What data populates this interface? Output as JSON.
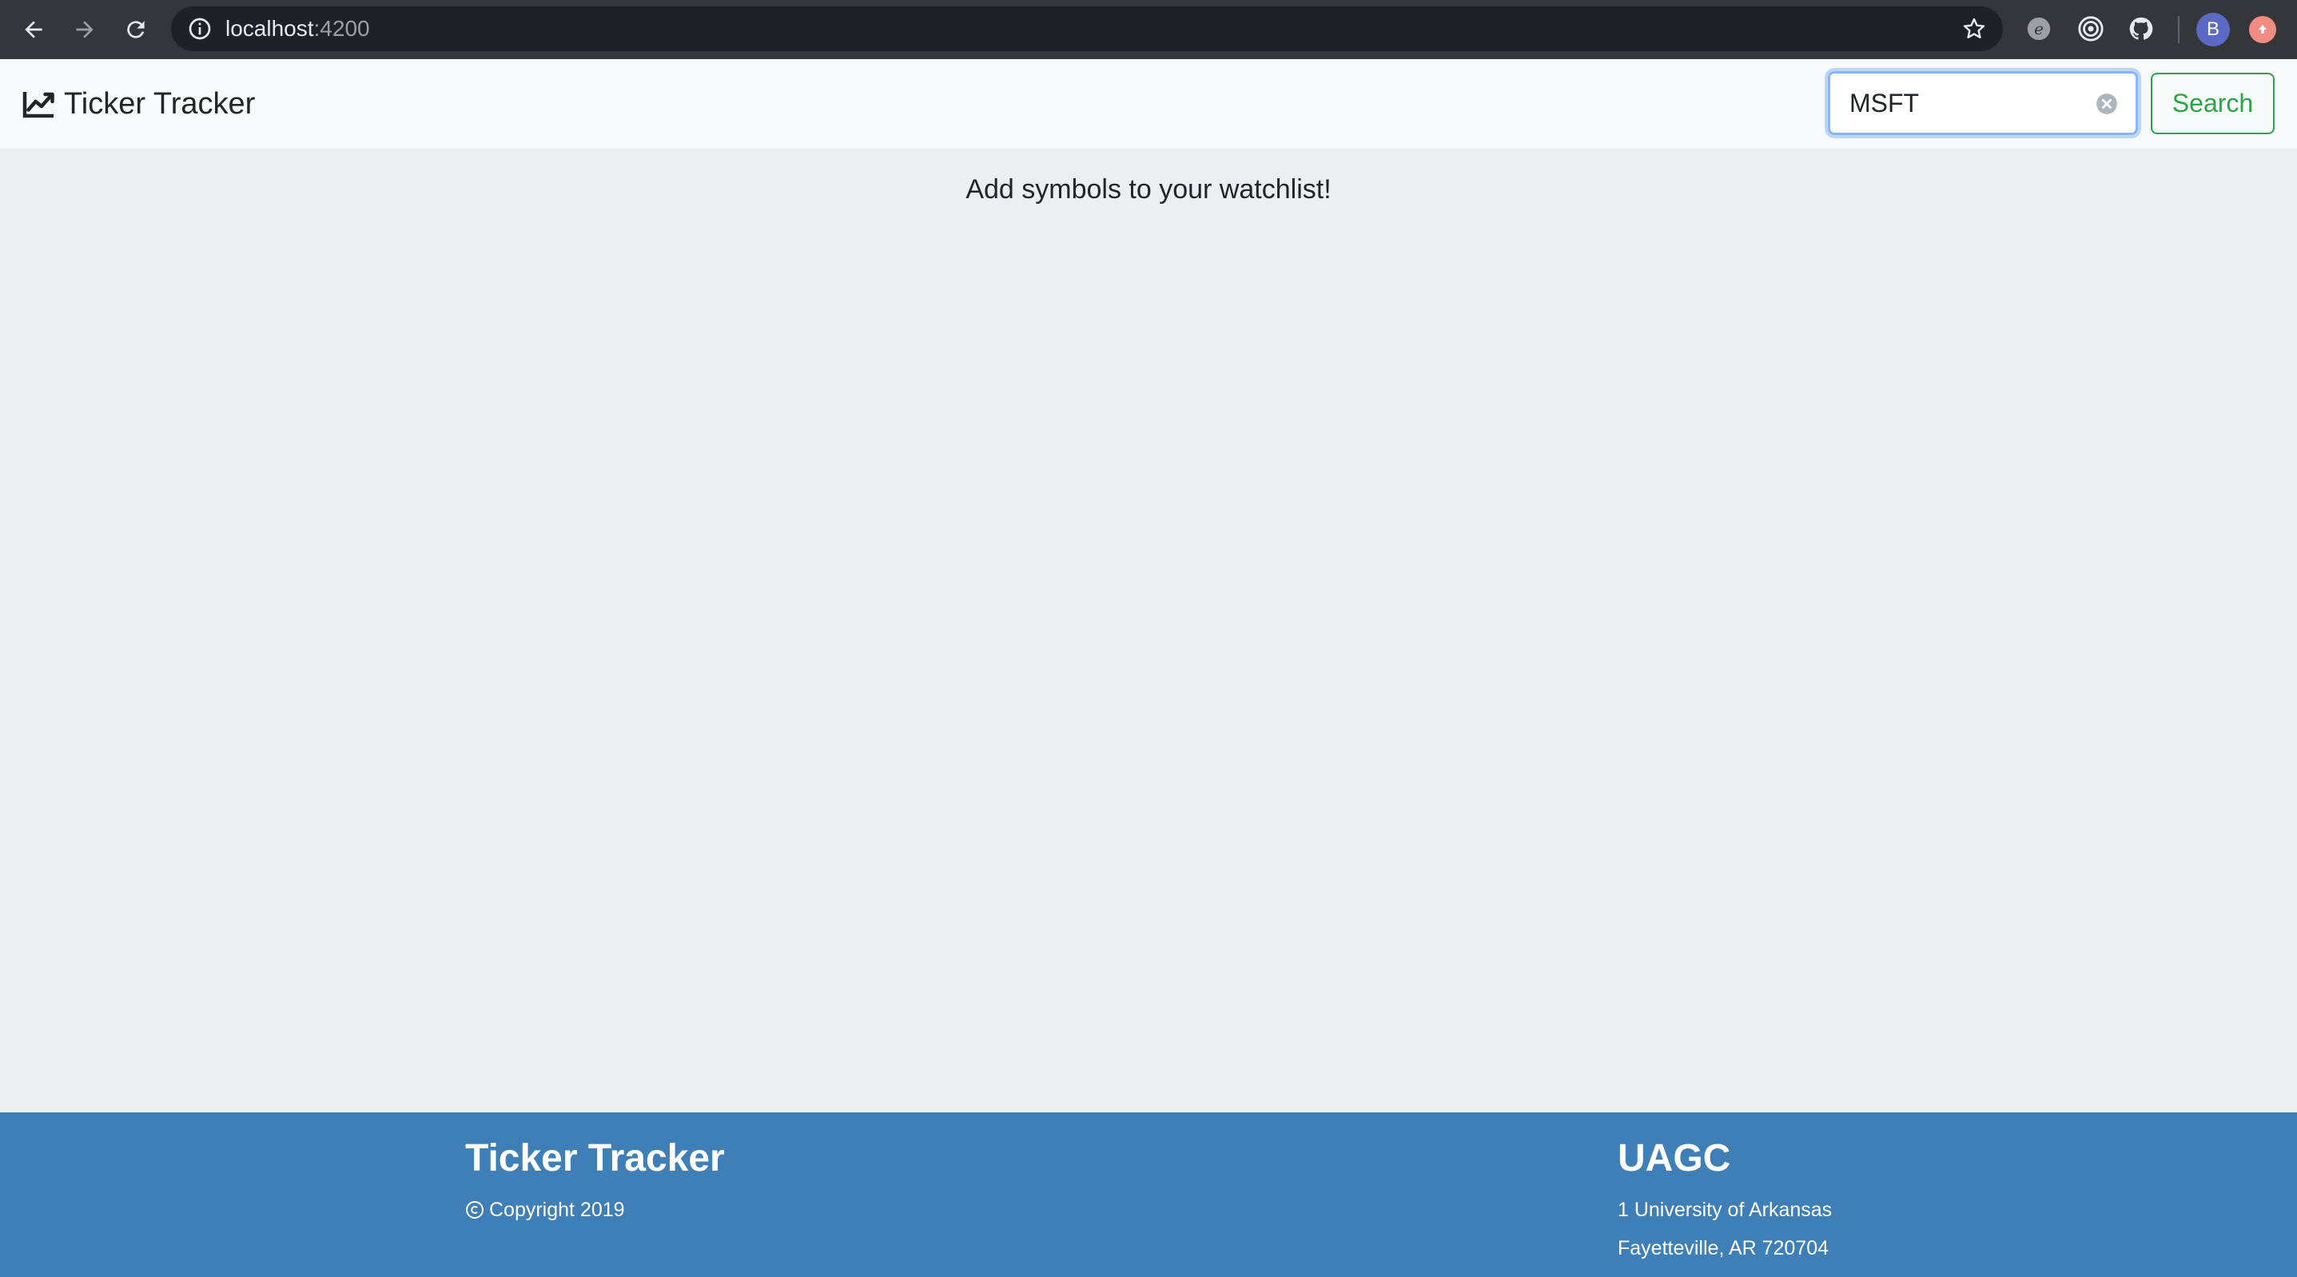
{
  "browser": {
    "url_host": "localhost",
    "url_port": ":4200",
    "profile_initial": "B",
    "icons": [
      "back-icon",
      "forward-icon",
      "reload-icon",
      "info-icon",
      "star-icon",
      "extension-icon",
      "target-icon",
      "github-icon",
      "update-icon"
    ]
  },
  "navbar": {
    "brand_label": "Ticker Tracker",
    "brand_icon": "chart-line-icon",
    "search_value": "MSFT",
    "search_button_label": "Search"
  },
  "main": {
    "message": "Add symbols to your watchlist!"
  },
  "footer": {
    "left_title": "Ticker Tracker",
    "copyright": "Copyright 2019",
    "right_title": "UAGC",
    "address_line1": "1 University of Arkansas",
    "address_line2": "Fayetteville, AR 720704"
  },
  "colors": {
    "navbar_bg": "#f8f9fa",
    "page_bg": "#eceff0",
    "footer_bg": "#3f7fb8",
    "search_button": "#28a745",
    "input_focus": "#86b7fe"
  }
}
